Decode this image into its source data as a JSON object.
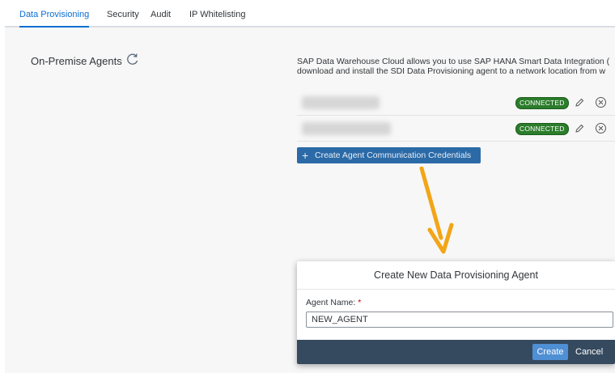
{
  "tabs": [
    {
      "label": "Data Provisioning",
      "active": true
    },
    {
      "label": "Security",
      "active": false
    },
    {
      "label": "Audit",
      "active": false
    },
    {
      "label": "IP Whitelisting",
      "active": false
    }
  ],
  "left_panel": {
    "title": "On-Premise Agents",
    "refresh_icon": "refresh-icon"
  },
  "description": {
    "line1": "SAP Data Warehouse Cloud allows you to use SAP HANA Smart Data Integration (",
    "line2": "download and install the SDI Data Provisioning agent to a network location from w"
  },
  "agents": [
    {
      "status": "CONNECTED"
    },
    {
      "status": "CONNECTED"
    }
  ],
  "create_credentials_button": "Create Agent Communication Credentials",
  "dialog": {
    "title": "Create New Data Provisioning Agent",
    "field_label": "Agent Name:",
    "required_marker": "*",
    "field_value": "NEW_AGENT",
    "create_label": "Create",
    "cancel_label": "Cancel"
  },
  "colors": {
    "accent": "#0a6ed1",
    "connected_badge": "#2b7c2b",
    "annotation_arrow": "#f2a516",
    "dialog_footer": "#354a5f"
  }
}
